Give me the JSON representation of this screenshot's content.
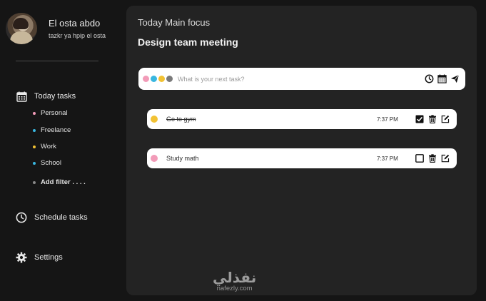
{
  "user": {
    "name": "El osta abdo",
    "subtitle": "tazkr ya hpip el osta"
  },
  "nav": {
    "today": "Today tasks",
    "schedule": "Schedule tasks",
    "settings": "Settings"
  },
  "filters": [
    {
      "label": "Personal",
      "color": "#f29bb8"
    },
    {
      "label": "Freelance",
      "color": "#39b7e0"
    },
    {
      "label": "Work",
      "color": "#f2c233"
    },
    {
      "label": "School",
      "color": "#39b7e0"
    }
  ],
  "add_filter": {
    "label": "Add filter . . . .",
    "color": "#8a8a8a"
  },
  "focus": {
    "label": "Today Main focus",
    "title": "Design team meeting"
  },
  "task_input": {
    "placeholder": "What is your next task?",
    "color_options": [
      "#f29bb8",
      "#39b7e0",
      "#f2c233",
      "#7a7a7a"
    ]
  },
  "tasks": [
    {
      "name": "Go to gym",
      "time": "7:37 PM",
      "color": "#f2c233",
      "done": true
    },
    {
      "name": "Study math",
      "time": "7:37 PM",
      "color": "#f29bb8",
      "done": false
    }
  ],
  "watermark": {
    "arabic": "نفذلي",
    "latin": "nafezly.com"
  }
}
